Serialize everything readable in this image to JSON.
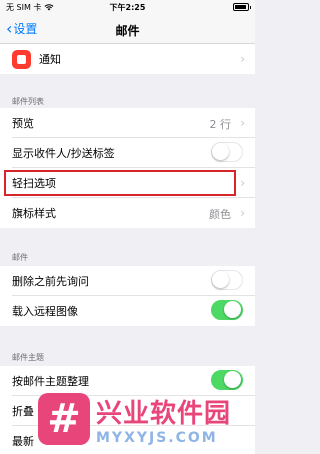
{
  "status_bar": {
    "carrier": "无 SIM 卡",
    "wifi_icon": "wifi-icon",
    "time": "下午2:25",
    "battery_level": 0.9
  },
  "nav": {
    "back_label": "设置",
    "title": "邮件"
  },
  "rows": {
    "notifications": "通知",
    "preview": "预览",
    "preview_value": "2 行",
    "show_to_cc": "显示收件人/抄送标签",
    "swipe_options": "轻扫选项",
    "flag_style": "旗标样式",
    "flag_style_value": "颜色",
    "ask_before_deleting": "删除之前先询问",
    "load_remote_images": "载入远程图像",
    "organize_by_thread": "按邮件主题整理",
    "collapse_read": "折叠",
    "most_recent": "最新"
  },
  "sections": {
    "message_list": "邮件列表",
    "messages": "邮件",
    "threading": "邮件主题"
  },
  "toggles": {
    "show_to_cc": false,
    "ask_before_deleting": false,
    "load_remote_images": true,
    "organize_by_thread": true
  },
  "watermark": {
    "logo_glyph": "#",
    "name": "兴业软件园",
    "url": "MYXYJS.COM"
  },
  "colors": {
    "accent": "#007aff",
    "toggle_on": "#4cd964",
    "highlight": "#d6262b",
    "notif_icon": "#ff3b30"
  }
}
